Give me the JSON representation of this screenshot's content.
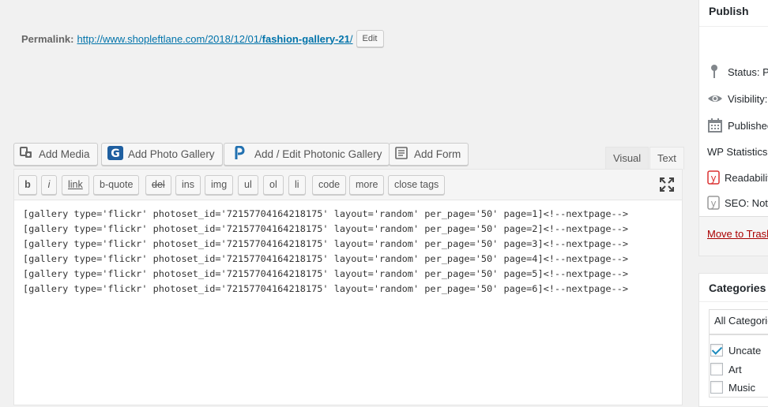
{
  "permalink": {
    "label": "Permalink:",
    "url_prefix": "http://www.shopleftlane.com/2018/12/01/",
    "slug": "fashion-gallery-21",
    "url_suffix": "/",
    "edit_label": "Edit"
  },
  "media_buttons": [
    {
      "label": "Add Media",
      "icon": "media-icon"
    },
    {
      "label": "Add Photo Gallery",
      "icon": "photo-gallery-icon"
    },
    {
      "label": "Add / Edit Photonic Gallery",
      "icon": "photonic-icon"
    },
    {
      "label": "Add Form",
      "icon": "form-icon"
    }
  ],
  "editor_tabs": {
    "visual": "Visual",
    "text": "Text",
    "active": "Text"
  },
  "quicktags": [
    "b",
    "i",
    "link",
    "b-quote",
    "del",
    "ins",
    "img",
    "ul",
    "ol",
    "li",
    "code",
    "more",
    "close tags"
  ],
  "content_lines": [
    "[gallery type='flickr' photoset_id='72157704164218175' layout='random' per_page='50' page=1]<!--nextpage-->",
    "[gallery type='flickr' photoset_id='72157704164218175' layout='random' per_page='50' page=2]<!--nextpage-->",
    "[gallery type='flickr' photoset_id='72157704164218175' layout='random' per_page='50' page=3]<!--nextpage-->",
    "[gallery type='flickr' photoset_id='72157704164218175' layout='random' per_page='50' page=4]<!--nextpage-->",
    "[gallery type='flickr' photoset_id='72157704164218175' layout='random' per_page='50' page=5]<!--nextpage-->",
    "[gallery type='flickr' photoset_id='72157704164218175' layout='random' per_page='50' page=6]<!--nextpage-->"
  ],
  "publish": {
    "title": "Publish",
    "status": "Status: Pu",
    "visibility": "Visibility:",
    "published": "Publishec",
    "wp_statistics": "WP Statistics",
    "readability": "Readabilit",
    "seo": "SEO: Not",
    "trash": "Move to Trash"
  },
  "categories": {
    "title": "Categories",
    "tab_all": "All Categorie",
    "items": [
      {
        "label": "Uncate",
        "checked": true
      },
      {
        "label": "Art",
        "checked": false
      },
      {
        "label": "Music",
        "checked": false
      }
    ]
  },
  "colors": {
    "link": "#0073aa",
    "trash": "#a00000",
    "yoast_red": "#dc3232",
    "checkbox": "#1e8cbe"
  }
}
